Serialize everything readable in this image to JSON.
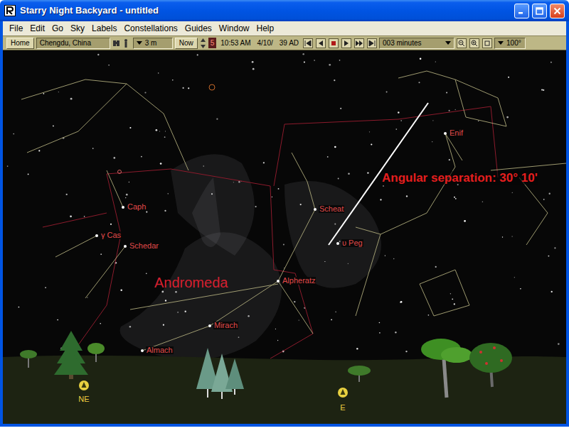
{
  "window": {
    "title": "Starry Night Backyard - untitled"
  },
  "menu": [
    "File",
    "Edit",
    "Go",
    "Sky",
    "Labels",
    "Constellations",
    "Guides",
    "Window",
    "Help"
  ],
  "toolbar": {
    "home": "Home",
    "location": "Chengdu, China",
    "elevation": "3 m",
    "now": "Now",
    "dst": "5",
    "time": "10:53 AM",
    "date": "4/10/",
    "year": "39 AD",
    "time_step": "003 minutes",
    "field_of_view": "100°"
  },
  "sky": {
    "constellation": "Andromeda",
    "measurement": "Angular separation: 30° 10'",
    "stars": [
      {
        "label": "Enif"
      },
      {
        "label": "Scheat"
      },
      {
        "label": "υ Peg"
      },
      {
        "label": "Caph"
      },
      {
        "label": "γ Cas"
      },
      {
        "label": "Schedar"
      },
      {
        "label": "Alpheratz"
      },
      {
        "label": "Mirach"
      },
      {
        "label": "Almach"
      }
    ]
  },
  "compass": [
    "NE",
    "E"
  ]
}
